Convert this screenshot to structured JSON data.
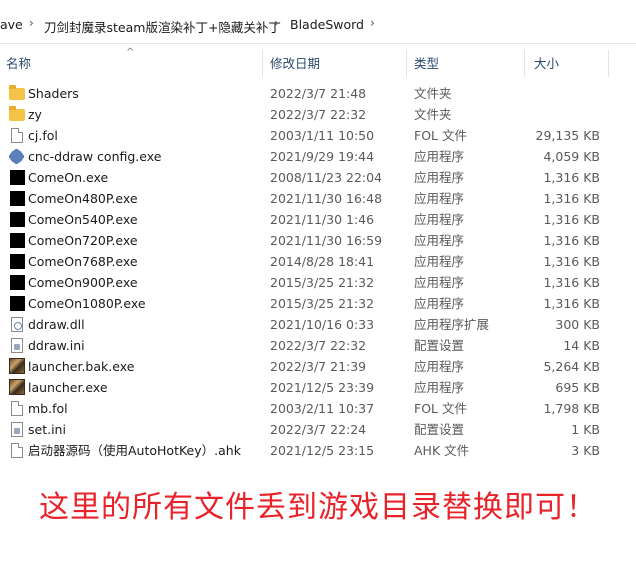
{
  "breadcrumb": {
    "items": [
      "ave",
      "刀剑封魔录steam版渲染补丁+隐藏关补丁",
      "BladeSword"
    ],
    "separator": "›"
  },
  "columns": {
    "name": "名称",
    "date": "修改日期",
    "type": "类型",
    "size": "大小",
    "sort_icon": "^"
  },
  "files": [
    {
      "icon": "folder",
      "name": "Shaders",
      "date": "2022/3/7 21:48",
      "type": "文件夹",
      "size": ""
    },
    {
      "icon": "folder",
      "name": "zy",
      "date": "2022/3/7 22:32",
      "type": "文件夹",
      "size": ""
    },
    {
      "icon": "doc",
      "name": "cj.fol",
      "date": "2003/1/11 10:50",
      "type": "FOL 文件",
      "size": "29,135 KB"
    },
    {
      "icon": "gear",
      "name": "cnc-ddraw config.exe",
      "date": "2021/9/29 19:44",
      "type": "应用程序",
      "size": "4,059 KB"
    },
    {
      "icon": "black",
      "name": "ComeOn.exe",
      "date": "2008/11/23 22:04",
      "type": "应用程序",
      "size": "1,316 KB"
    },
    {
      "icon": "black",
      "name": "ComeOn480P.exe",
      "date": "2021/11/30 16:48",
      "type": "应用程序",
      "size": "1,316 KB"
    },
    {
      "icon": "black",
      "name": "ComeOn540P.exe",
      "date": "2021/11/30 1:46",
      "type": "应用程序",
      "size": "1,316 KB"
    },
    {
      "icon": "black",
      "name": "ComeOn720P.exe",
      "date": "2021/11/30 16:59",
      "type": "应用程序",
      "size": "1,316 KB"
    },
    {
      "icon": "black",
      "name": "ComeOn768P.exe",
      "date": "2014/8/28 18:41",
      "type": "应用程序",
      "size": "1,316 KB"
    },
    {
      "icon": "black",
      "name": "ComeOn900P.exe",
      "date": "2015/3/25 21:32",
      "type": "应用程序",
      "size": "1,316 KB"
    },
    {
      "icon": "black",
      "name": "ComeOn1080P.exe",
      "date": "2015/3/25 21:32",
      "type": "应用程序",
      "size": "1,316 KB"
    },
    {
      "icon": "dll",
      "name": "ddraw.dll",
      "date": "2021/10/16 0:33",
      "type": "应用程序扩展",
      "size": "300 KB"
    },
    {
      "icon": "ini",
      "name": "ddraw.ini",
      "date": "2022/3/7 22:32",
      "type": "配置设置",
      "size": "14 KB"
    },
    {
      "icon": "launcher",
      "name": "launcher.bak.exe",
      "date": "2022/3/7 21:39",
      "type": "应用程序",
      "size": "5,264 KB"
    },
    {
      "icon": "launcher",
      "name": "launcher.exe",
      "date": "2021/12/5 23:39",
      "type": "应用程序",
      "size": "695 KB"
    },
    {
      "icon": "doc",
      "name": "mb.fol",
      "date": "2003/2/11 10:37",
      "type": "FOL 文件",
      "size": "1,798 KB"
    },
    {
      "icon": "ini",
      "name": "set.ini",
      "date": "2022/3/7 22:24",
      "type": "配置设置",
      "size": "1 KB"
    },
    {
      "icon": "doc",
      "name": "启动器源码（使用AutoHotKey）.ahk",
      "date": "2021/12/5 23:15",
      "type": "AHK 文件",
      "size": "3 KB"
    }
  ],
  "banner": {
    "text": "这里的所有文件丢到游戏目录替换即可！",
    "color": "#e8232a"
  }
}
